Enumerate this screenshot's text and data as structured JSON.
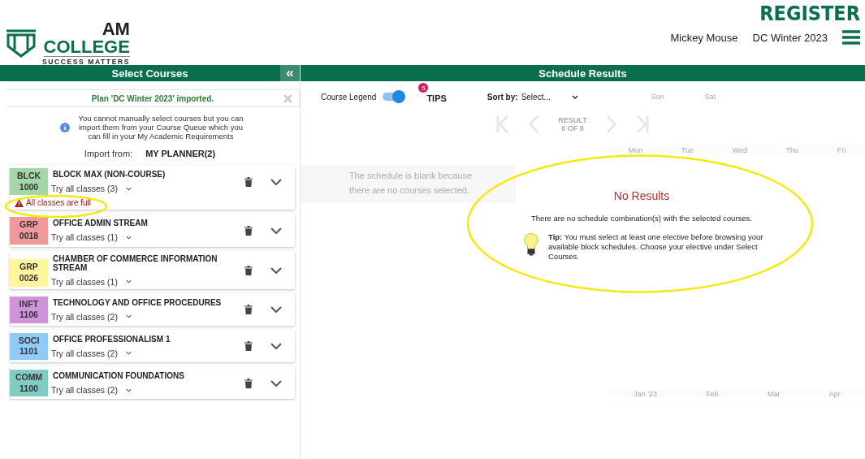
{
  "header": {
    "logo_top": "AM",
    "logo_name": "COLLEGE",
    "logo_tagline": "SUCCESS MATTERS",
    "register": "REGISTER",
    "user": "Mickey Mouse",
    "term": "DC Winter 2023"
  },
  "left_panel": {
    "title": "Select Courses",
    "collapse": "«",
    "notice": "Plan 'DC Winter 2023' imported.",
    "info": "You cannot manually select courses but you can import them from your Course Queue which you can fill in your My Academic Requirements",
    "import_label": "Import from:",
    "import_source": "MY PLANNER(2)",
    "courses": [
      {
        "subject": "BLCK",
        "number": "1000",
        "title": "BLOCK MAX (NON-COURSE)",
        "color": "#a5d6a7",
        "classes": "Try all classes (3)",
        "warning": "All classes are full"
      },
      {
        "subject": "GRP",
        "number": "0018",
        "title": "OFFICE ADMIN STREAM",
        "color": "#ef9a9a",
        "classes": "Try all classes (1)"
      },
      {
        "subject": "GRP",
        "number": "0026",
        "title": "CHAMBER OF COMMERCE INFORMATION STREAM",
        "color": "#fff59d",
        "classes": "Try all classes (1)"
      },
      {
        "subject": "INFT",
        "number": "1106",
        "title": "TECHNOLOGY AND OFFICE PROCEDURES",
        "color": "#ce93d8",
        "classes": "Try all classes (2)"
      },
      {
        "subject": "SOCI",
        "number": "1101",
        "title": "OFFICE PROFESSIONALISM 1",
        "color": "#90caf9",
        "classes": "Try all classes (2)"
      },
      {
        "subject": "COMM",
        "number": "1100",
        "title": "COMMUNICATION FOUNDATIONS",
        "color": "#80cbc4",
        "classes": "Try all classes (2)"
      }
    ]
  },
  "right_panel": {
    "title": "Schedule Results",
    "legend_label": "Course Legend",
    "legend_on": true,
    "tips_count": "5",
    "tips_label": "TIPS",
    "sort_label": "Sort by:",
    "sort_value": "Select...",
    "range_start": "Sun",
    "range_end": "Sat",
    "result_label": "RESULT",
    "result_count": "0 OF 0",
    "blank_message": "The schedule is blank because there are no courses selected.",
    "days": [
      "Mon",
      "Tue",
      "Wed",
      "Thu",
      "Fri"
    ],
    "months": [
      "Jan '23",
      "Feb",
      "Mar",
      "Apr"
    ],
    "dialog": {
      "title": "No Results",
      "message": "There are no schedule combination(s) with the selected courses.",
      "tip": "**Tip:** You must select at least one elective before browsing your available block schedules. Choose your elective under Select Courses."
    }
  }
}
